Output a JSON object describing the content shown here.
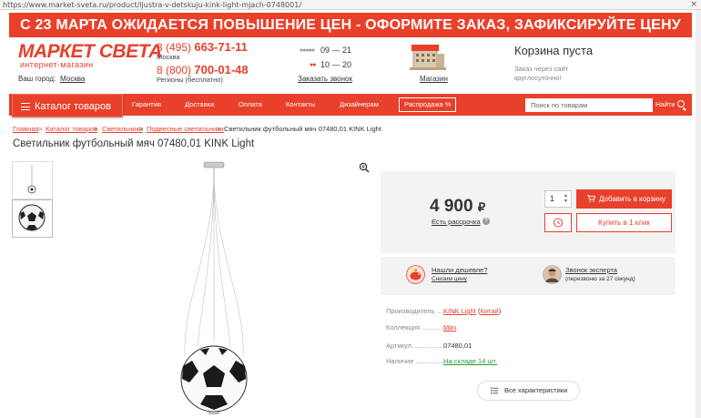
{
  "browser": {
    "url": "https://www.market-sveta.ru/product/ljustra-v-detskuju-kink-light-mjach-0748001/",
    "close_glyph": "×"
  },
  "promo": {
    "text": "С 23 МАРТА ОЖИДАЕТСЯ ПОВЫШЕНИЕ ЦЕН - ОФОРМИТЕ ЗАКАЗ, ЗАФИКСИРУЙТЕ ЦЕНУ"
  },
  "header": {
    "logo": "МАРКЕТ СВЕТА",
    "logo_sub": "интернет-магазин",
    "city_label": "Ваш город:",
    "city": "Москва",
    "phones": [
      {
        "code": "8 (495) ",
        "number": "663-71-11",
        "sub": "Москва"
      },
      {
        "code": "8 (800) ",
        "number": "700-01-48",
        "sub": "Регионы (бесплатно)"
      }
    ],
    "hours": [
      "09 — 21",
      "10 — 20"
    ],
    "callback": "Заказать звонок",
    "shop": "Магазин",
    "cart_title": "Корзина пуста",
    "cart_sub": "Заказ через сайт круглосуточно!"
  },
  "nav": {
    "catalog": "Каталог товаров",
    "items": [
      "Гарантия",
      "Доставка",
      "Оплата",
      "Контакты",
      "Дизайнерам"
    ],
    "sale": "Распродажа %",
    "search_placeholder": "Поиск по товарам",
    "search_button": "Найти"
  },
  "breadcrumbs": [
    "Главная",
    "Каталог товаров",
    "Светильники",
    "Подвесные светильники"
  ],
  "breadcrumb_sep": ">",
  "breadcrumb_current": "Светильник футбольный мяч 07480,01 KINK Light",
  "product": {
    "title": "Светильник футбольный мяч 07480,01 KINK Light",
    "price": "4 900",
    "currency": "₽",
    "installment": "Есть рассрочка",
    "info_glyph": "?",
    "qty": "1",
    "add_to_cart": "Добавить в корзину",
    "one_click": "Купить в 1 клик",
    "cheaper_title": "Нашли дешевле?",
    "cheaper_sub": "Снизим цену",
    "expert_title": "Звонок эксперта",
    "expert_sub": "(перезвоню за 27 секунд)",
    "specs": [
      {
        "key": "Производитель",
        "value": "KINK Light",
        "extra": "Китай"
      },
      {
        "key": "Коллекция",
        "value": "Мяч"
      },
      {
        "key": "Артикул",
        "value": "07480,01"
      },
      {
        "key": "Наличие",
        "value": "На складе 14 шт."
      }
    ],
    "all_specs": "Все характеристики"
  },
  "colors": {
    "accent": "#e8402a",
    "stock": "#2e9a2e",
    "panel": "#f3f3f3"
  }
}
